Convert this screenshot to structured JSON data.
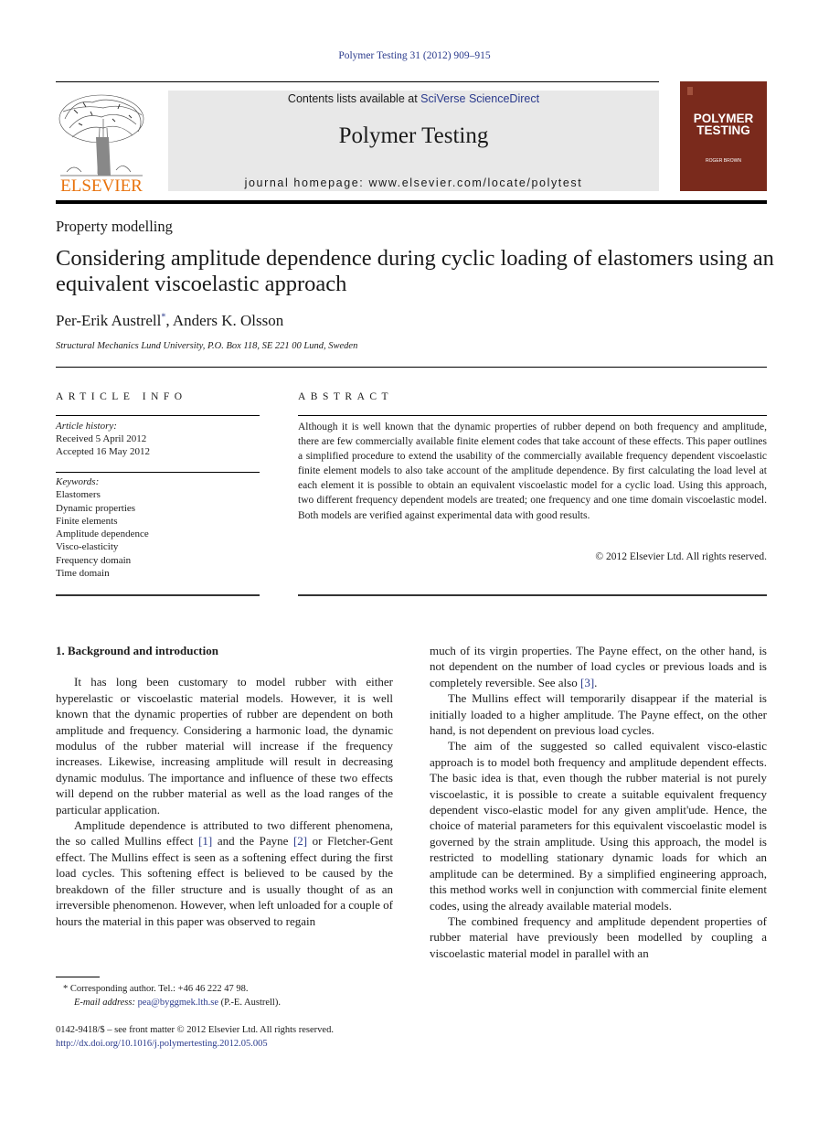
{
  "header": {
    "journal_ref": "Polymer Testing 31 (2012) 909–915",
    "contents_prefix": "Contents lists available at ",
    "contents_link": "SciVerse ScienceDirect",
    "journal_title": "Polymer Testing",
    "homepage": "journal homepage: www.elsevier.com/locate/polytest",
    "publisher_logo_text": "ELSEVIER",
    "cover": {
      "title_line1": "POLYMER",
      "title_line2": "TESTING",
      "editor": "ROGER BROWN",
      "color": "#7a2a1c"
    },
    "publisher_color": "#e8720c",
    "link_color": "#2a3a8c"
  },
  "article": {
    "section": "Property modelling",
    "title": "Considering amplitude dependence during cyclic loading of elastomers using an equivalent viscoelastic approach",
    "author1": "Per-Erik Austrell",
    "author1_mark": "*",
    "author_sep": ", ",
    "author2": "Anders K. Olsson",
    "affiliation": "Structural Mechanics Lund University, P.O. Box 118, SE 221 00 Lund, Sweden"
  },
  "article_info": {
    "heading": "ARTICLE INFO",
    "history_label": "Article history:",
    "received": "Received 5 April 2012",
    "accepted": "Accepted 16 May 2012",
    "keywords_label": "Keywords:",
    "keywords": [
      "Elastomers",
      "Dynamic properties",
      "Finite elements",
      "Amplitude dependence",
      "Visco-elasticity",
      "Frequency domain",
      "Time domain"
    ]
  },
  "abstract": {
    "heading": "ABSTRACT",
    "text": "Although it is well known that the dynamic properties of rubber depend on both frequency and amplitude, there are few commercially available finite element codes that take account of these effects. This paper outlines a simplified procedure to extend the usability of the commercially available frequency dependent viscoelastic finite element models to also take account of the amplitude dependence. By first calculating the load level at each element it is possible to obtain an equivalent viscoelastic model for a cyclic load. Using this approach, two different frequency dependent models are treated; one frequency and one time domain viscoelastic model. Both models are verified against experimental data with good results.",
    "copyright": "© 2012 Elsevier Ltd. All rights reserved."
  },
  "body": {
    "section_heading": "1.  Background and introduction",
    "col1_p1": "It has long been customary to model rubber with either hyperelastic or viscoelastic material models. However, it is well known that the dynamic properties of rubber are dependent on both amplitude and frequency. Considering a harmonic load, the dynamic modulus of the rubber material will increase if the frequency increases. Likewise, increasing amplitude will result in decreasing dynamic modulus. The importance and influence of these two effects will depend on the rubber material as well as the load ranges of the particular application.",
    "col1_p2_a": "Amplitude dependence is attributed to two different phenomena, the so called Mullins effect ",
    "ref1": "[1]",
    "col1_p2_b": " and the Payne ",
    "ref2": "[2]",
    "col1_p2_c": " or Fletcher-Gent effect. The Mullins effect is seen as a softening effect during the first load cycles. This softening effect is believed to be caused by the breakdown of the filler structure and is usually thought of as an irreversible phenomenon. However, when left unloaded for a couple of hours the material in this paper was observed to regain",
    "col2_p1_a": "much of its virgin properties. The Payne effect, on the other hand, is not dependent on the number of load cycles or previous loads and is completely reversible. See also ",
    "ref3": "[3]",
    "col2_p1_b": ".",
    "col2_p2": "The Mullins effect will temporarily disappear if the material is initially loaded to a higher amplitude. The Payne effect, on the other hand, is not dependent on previous load cycles.",
    "col2_p3": "The aim of the suggested so called equivalent visco-elastic approach is to model both frequency and amplitude dependent effects. The basic idea is that, even though the rubber material is not purely viscoelastic, it is possible to create a suitable equivalent frequency dependent visco-elastic model for any given amplit'ude. Hence, the choice of material parameters for this equivalent viscoelastic model is governed by the strain amplitude. Using this approach, the model is restricted to modelling stationary dynamic loads for which an amplitude can be determined. By a simplified engineering approach, this method works well in conjunction with commercial finite element codes, using the already available material models.",
    "col2_p4": "The combined frequency and amplitude dependent properties of rubber material have previously been modelled by coupling a viscoelastic material model in parallel with an"
  },
  "footnote": {
    "mark": "*",
    "corresponding": " Corresponding author. Tel.: +46 46 222 47 98.",
    "email_label": "E-mail address: ",
    "email": "pea@byggmek.lth.se",
    "email_suffix": " (P.-E. Austrell)."
  },
  "issn": {
    "line": "0142-9418/$ – see front matter © 2012 Elsevier Ltd. All rights reserved.",
    "doi": "http://dx.doi.org/10.1016/j.polymertesting.2012.05.005"
  }
}
